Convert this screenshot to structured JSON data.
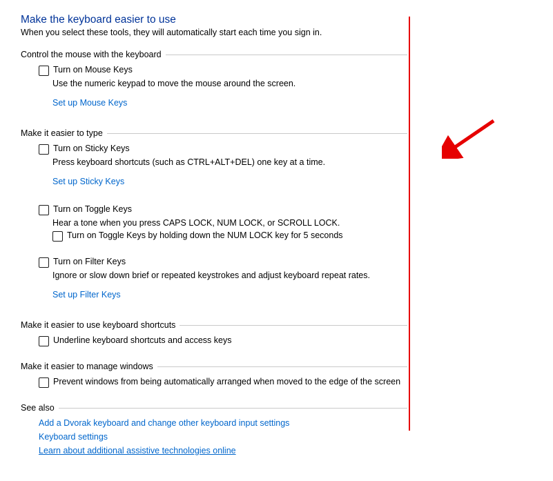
{
  "title": "Make the keyboard easier to use",
  "subtitle": "When you select these tools, they will automatically start each time you sign in.",
  "sections": {
    "mouse": {
      "heading": "Control the mouse with the keyboard",
      "cbMouseKeys": "Turn on Mouse Keys",
      "descMouseKeys": "Use the numeric keypad to move the mouse around the screen.",
      "linkMouseKeys": "Set up Mouse Keys"
    },
    "type": {
      "heading": "Make it easier to type",
      "cbSticky": "Turn on Sticky Keys",
      "descSticky": "Press keyboard shortcuts (such as CTRL+ALT+DEL) one key at a time.",
      "linkSticky": "Set up Sticky Keys",
      "cbToggle": "Turn on Toggle Keys",
      "descToggle": "Hear a tone when you press CAPS LOCK, NUM LOCK, or SCROLL LOCK.",
      "cbToggleHold": "Turn on Toggle Keys by holding down the NUM LOCK key for 5 seconds",
      "cbFilter": "Turn on Filter Keys",
      "descFilter": "Ignore or slow down brief or repeated keystrokes and adjust keyboard repeat rates.",
      "linkFilter": "Set up Filter Keys"
    },
    "shortcuts": {
      "heading": "Make it easier to use keyboard shortcuts",
      "cbUnderline": "Underline keyboard shortcuts and access keys"
    },
    "windows": {
      "heading": "Make it easier to manage windows",
      "cbPrevent": "Prevent windows from being automatically arranged when moved to the edge of the screen"
    },
    "seealso": {
      "heading": "See also",
      "linkDvorak": "Add a Dvorak keyboard and change other keyboard input settings",
      "linkKbd": "Keyboard settings",
      "linkAssist": "Learn about additional assistive technologies online"
    }
  }
}
